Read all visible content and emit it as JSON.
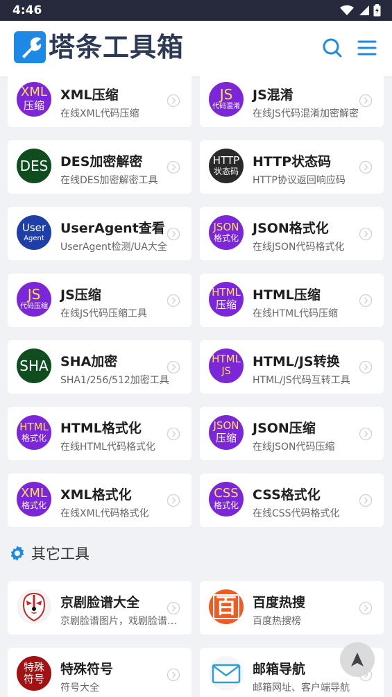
{
  "status_bar": {
    "time": "4:46"
  },
  "header": {
    "logo_text": "塔条工具箱"
  },
  "tools": [
    {
      "badge_top": "XML",
      "badge_bottom": "压缩",
      "color": "#7b26d8",
      "text_color": "#ffe14a",
      "title": "XML压缩",
      "desc": "在线XML代码压缩"
    },
    {
      "badge_top": "JS",
      "badge_bottom": "代码混淆",
      "color": "#7b26d8",
      "text_color": "#ffe14a",
      "title": "JS混淆",
      "desc": "在线JS代码混淆加密解密"
    },
    {
      "badge_top": "DES",
      "badge_bottom": "",
      "color": "#0f4d1f",
      "text_color": "#ffffff",
      "title": "DES加密解密",
      "desc": "在线DES加密解密工具"
    },
    {
      "badge_top": "HTTP",
      "badge_bottom": "状态码",
      "color": "#2a2a2a",
      "text_color": "#ffffff",
      "title": "HTTP状态码",
      "desc": "HTTP协议返回响应码"
    },
    {
      "badge_top": "User",
      "badge_bottom": "Agent",
      "color": "#1f3fa8",
      "text_color": "#ffffff",
      "title": "UserAgent查看",
      "desc": "UserAgent检测/UA大全"
    },
    {
      "badge_top": "JSON",
      "badge_bottom": "格式化",
      "color": "#7b26d8",
      "text_color": "#ffe14a",
      "title": "JSON格式化",
      "desc": "在线JSON代码格式化"
    },
    {
      "badge_top": "JS",
      "badge_bottom": "代码压缩",
      "color": "#7b26d8",
      "text_color": "#ffe14a",
      "title": "JS压缩",
      "desc": "在线JS代码压缩工具"
    },
    {
      "badge_top": "HTML",
      "badge_bottom": "压缩",
      "color": "#7b26d8",
      "text_color": "#ffe14a",
      "title": "HTML压缩",
      "desc": "在线HTML代码压缩"
    },
    {
      "badge_top": "SHA",
      "badge_bottom": "",
      "color": "#0f4d1f",
      "text_color": "#ffffff",
      "title": "SHA加密",
      "desc": "SHA1/256/512加密工具"
    },
    {
      "badge_top": "HTML",
      "badge_bottom": "JS",
      "color": "#7b26d8",
      "text_color": "#ffe14a",
      "title": "HTML/JS转换",
      "desc": "HTML/JS代码互转工具"
    },
    {
      "badge_top": "HTML",
      "badge_bottom": "格式化",
      "color": "#7b26d8",
      "text_color": "#ffe14a",
      "title": "HTML格式化",
      "desc": "在线HTML代码格式化"
    },
    {
      "badge_top": "JSON",
      "badge_bottom": "压缩",
      "color": "#7b26d8",
      "text_color": "#ffe14a",
      "title": "JSON压缩",
      "desc": "在线JSON代码压缩"
    },
    {
      "badge_top": "XML",
      "badge_bottom": "格式化",
      "color": "#7b26d8",
      "text_color": "#ffe14a",
      "title": "XML格式化",
      "desc": "在线XML代码格式化"
    },
    {
      "badge_top": "CSS",
      "badge_bottom": "格式化",
      "color": "#7b26d8",
      "text_color": "#ffe14a",
      "title": "CSS格式化",
      "desc": "在线CSS代码格式化"
    }
  ],
  "other_section": {
    "title": "其它工具",
    "items": [
      {
        "title": "京剧脸谱大全",
        "desc": "京剧脸谱图片，戏剧脸谱大全",
        "icon": "opera-mask-icon"
      },
      {
        "title": "百度热搜",
        "desc": "百度热搜榜",
        "icon_text": "百",
        "icon": "baidu-hot-icon"
      },
      {
        "title": "特殊符号",
        "badge_top": "特殊",
        "badge_bottom": "符号",
        "desc": "符号大全",
        "icon": "special-symbol-icon"
      },
      {
        "title": "邮箱导航",
        "desc": "邮箱网址、客户端导航",
        "icon": "mail-icon"
      }
    ]
  },
  "colors": {
    "accent": "#1e88e5",
    "header_bg": "#262a3c",
    "purple": "#7b26d8",
    "badge_text": "#ffe14a"
  }
}
